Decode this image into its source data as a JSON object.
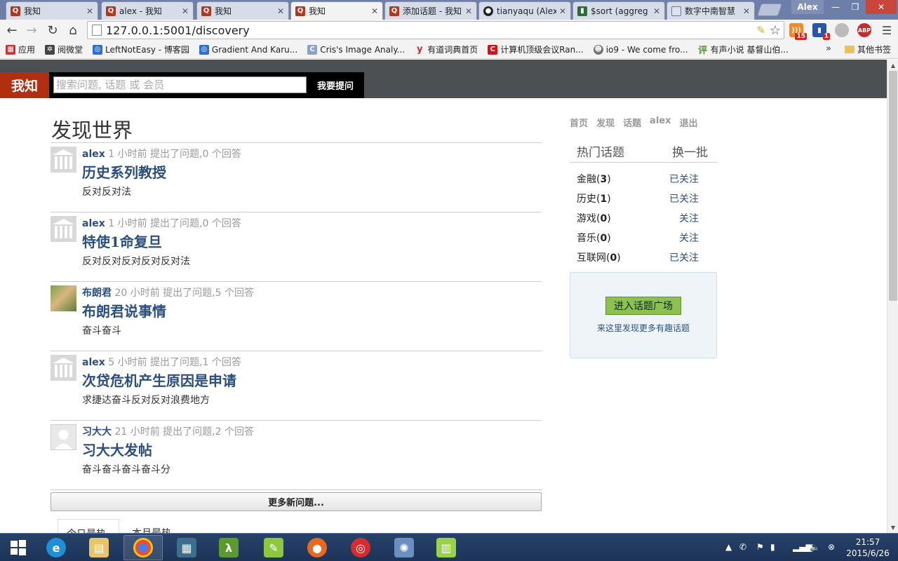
{
  "browser": {
    "tabs": [
      {
        "title": "我知",
        "favicon": "Q",
        "active": false
      },
      {
        "title": "alex - 我知",
        "favicon": "Q",
        "active": false
      },
      {
        "title": "我知",
        "favicon": "Q",
        "active": false
      },
      {
        "title": "我知",
        "favicon": "Q",
        "active": true
      },
      {
        "title": "添加话题 - 我知",
        "favicon": "Q",
        "active": false
      },
      {
        "title": "tianyaqu (Alex",
        "favicon": "github",
        "active": false
      },
      {
        "title": "$sort (aggreg",
        "favicon": "mongodb",
        "active": false
      },
      {
        "title": "数字中南智慧",
        "favicon": "image",
        "active": false
      }
    ],
    "user_label": "Alex",
    "url": "127.0.0.1:5001/discovery",
    "rss_badge": "15",
    "chart_badge": "1",
    "abp_label": "ABP",
    "bookmarks": [
      {
        "label": "应用",
        "icon": "apps-icon"
      },
      {
        "label": "阅微堂",
        "icon": "yuewei-icon"
      },
      {
        "label": "LeftNotEasy - 博客园",
        "icon": "blog-icon"
      },
      {
        "label": "Gradient And Karu...",
        "icon": "gradient-icon"
      },
      {
        "label": "Cris's Image Analy...",
        "icon": "cris-icon"
      },
      {
        "label": "有道词典首页",
        "icon": "youdao-icon"
      },
      {
        "label": "计算机顶级会议Ran...",
        "icon": "conference-icon"
      },
      {
        "label": "io9 - We come fro...",
        "icon": "io9-icon"
      },
      {
        "label": "有声小说 基督山伯...",
        "icon": "audio-novel-icon"
      }
    ],
    "bookmarks_overflow": "»",
    "other_bookmarks": "其他书签"
  },
  "site": {
    "logo": "我知",
    "search_placeholder": "搜索问题, 话题 或 会员",
    "ask_button": "我要提问",
    "page_title": "发现世界",
    "feed": [
      {
        "user": "alex",
        "meta": "1 小时前 提出了问题,0 个回答",
        "title": "历史系列教授",
        "body": "反对反对法",
        "avatar": "default"
      },
      {
        "user": "alex",
        "meta": "1 小时前 提出了问题,0 个回答",
        "title": "特使1命复旦",
        "body": "反对反对反对反对反对法",
        "avatar": "default"
      },
      {
        "user": "布朗君",
        "meta": "20 小时前 提出了问题,5 个回答",
        "title": "布朗君说事情",
        "body": "奋斗奋斗",
        "avatar": "photo"
      },
      {
        "user": "alex",
        "meta": "5 小时前 提出了问题,1 个回答",
        "title": "次贷危机产生原因是申请",
        "body": "求捷达奋斗反对反对浪费地方",
        "avatar": "default"
      },
      {
        "user": "习大大",
        "meta": "21 小时前 提出了问题,2 个回答",
        "title": "习大大发帖",
        "body": "奋斗奋斗奋斗奋斗分",
        "avatar": "blank"
      }
    ],
    "more_button": "更多新问题...",
    "bottom_tabs": [
      "今日最热",
      "本月最热"
    ],
    "nav": [
      "首页",
      "发现",
      "话题",
      "alex",
      "退出"
    ],
    "hot_topics_title": "热门话题",
    "refresh_label": "换一批",
    "topics": [
      {
        "name": "金融",
        "count": "3",
        "follow": "已关注"
      },
      {
        "name": "历史",
        "count": "1",
        "follow": "已关注"
      },
      {
        "name": "游戏",
        "count": "0",
        "follow": "关注"
      },
      {
        "name": "音乐",
        "count": "0",
        "follow": "关注"
      },
      {
        "name": "互联网",
        "count": "0",
        "follow": "已关注"
      }
    ],
    "square_button": "进入话题广场",
    "square_hint": "来这里发现更多有趣话题"
  },
  "taskbar": {
    "clock_time": "21:57",
    "clock_date": "2015/6/26"
  },
  "colors": {
    "brand_red": "#b22e10",
    "header_bg": "#4c5052",
    "link_blue": "#2a4f7f",
    "square_green": "#8cc04f"
  }
}
